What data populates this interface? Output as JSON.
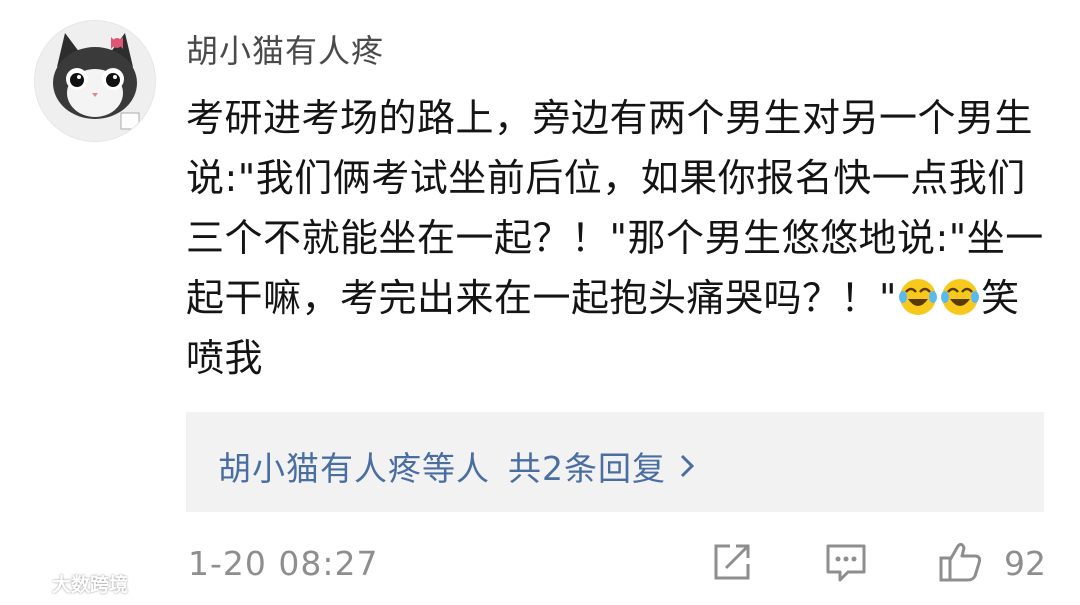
{
  "comment": {
    "username": "胡小猫有人疼",
    "text_parts": [
      "考研进考场的路上，旁边有两个男生对另一个男生说:\"我们俩考试坐前后位，如果你报名快一点我们三个不就能坐在一起？！\"那个男生悠悠地说:\"坐一起干嘛，考完出来在一起抱头痛哭吗？！\"",
      "笑喷我"
    ],
    "emojis": [
      "laugh-cry-emoji",
      "laugh-cry-emoji"
    ],
    "avatar_icon": "cat-avatar"
  },
  "replies": {
    "who": "胡小猫有人疼等人",
    "count_text": "共2条回复",
    "chevron_icon": "chevron-right-icon"
  },
  "footer": {
    "timestamp": "1-20 08:27",
    "actions": {
      "share_icon": "share-icon",
      "comment_icon": "comment-icon",
      "like_icon": "thumbs-up-icon",
      "like_count": "92"
    }
  },
  "watermark": {
    "text": "大数跨境"
  },
  "colors": {
    "reply_link": "#4a6ea2",
    "meta_gray": "#8e8e8e",
    "reply_bg": "#f2f2f2"
  }
}
